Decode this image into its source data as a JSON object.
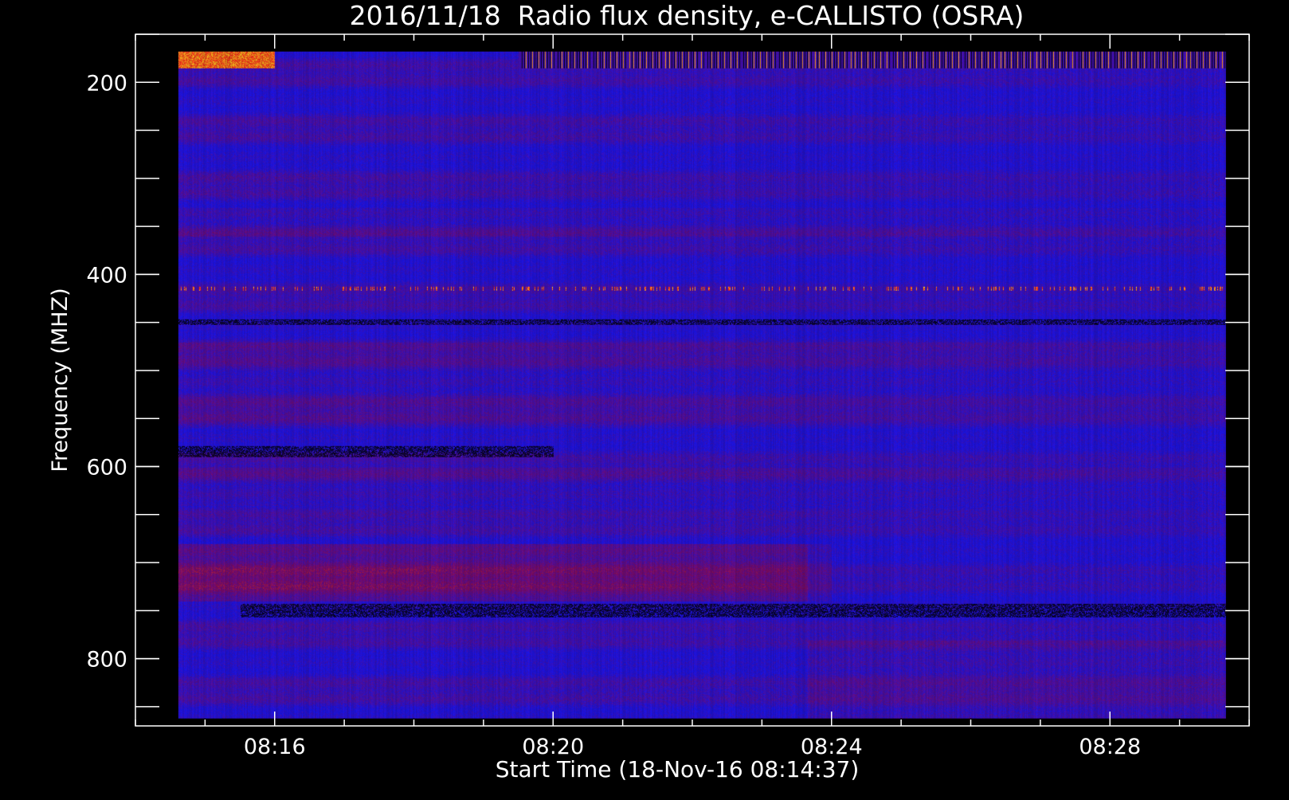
{
  "chart_data": {
    "type": "heatmap",
    "title": "2016/11/18  Radio flux density, e-CALLISTO (OSRA)",
    "xlabel": "Start Time (18-Nov-16 08:14:37)",
    "ylabel": "Frequency (MHZ)",
    "x": {
      "unit": "time of day",
      "start": "08:14:37",
      "range": [
        "08:14:00",
        "08:30:00"
      ],
      "data_range": [
        "08:14:37",
        "08:29:40"
      ],
      "major_ticks": [
        {
          "label": "08:16",
          "value": "08:16"
        },
        {
          "label": "08:20",
          "value": "08:20"
        },
        {
          "label": "08:24",
          "value": "08:24"
        },
        {
          "label": "08:28",
          "value": "08:28"
        }
      ],
      "minor_tick_interval_minutes": 1
    },
    "y": {
      "unit": "MHz",
      "inverted": true,
      "range": [
        150,
        870
      ],
      "data_range": [
        168,
        862
      ],
      "major_ticks": [
        {
          "label": "200",
          "value": 200
        },
        {
          "label": "400",
          "value": 400
        },
        {
          "label": "600",
          "value": 600
        },
        {
          "label": "800",
          "value": 800
        }
      ],
      "minor_tick_interval": 50
    },
    "colormap": [
      "#000000",
      "#0000ff",
      "#8b1a3a",
      "#ff3000",
      "#ffa040"
    ],
    "features": [
      {
        "description_type": "bright band",
        "freq_mhz": [
          168,
          185
        ],
        "time": [
          "08:14:37",
          "08:16:00"
        ],
        "level": "high"
      },
      {
        "description_type": "periodic spikes",
        "freq_mhz": [
          168,
          185
        ],
        "time": [
          "08:19:30",
          "08:29:40"
        ],
        "level": "high"
      },
      {
        "description_type": "intermittent line",
        "freq_mhz": [
          412,
          416
        ],
        "time": [
          "08:14:37",
          "08:29:40"
        ],
        "level": "medium"
      },
      {
        "description_type": "dark band",
        "freq_mhz": [
          446,
          452
        ],
        "time": [
          "08:14:37",
          "08:29:40"
        ],
        "level": "low"
      },
      {
        "description_type": "dark band",
        "freq_mhz": [
          578,
          590
        ],
        "time": [
          "08:14:37",
          "08:20:00"
        ],
        "level": "low"
      },
      {
        "description_type": "dark band",
        "freq_mhz": [
          742,
          756
        ],
        "time": [
          "08:15:30",
          "08:29:40"
        ],
        "level": "low"
      },
      {
        "description_type": "warm band",
        "freq_mhz": [
          680,
          740
        ],
        "time": [
          "08:14:37",
          "08:24:00"
        ],
        "level": "medium"
      }
    ]
  },
  "colors": {
    "background": "#000000",
    "axis": "#ffffff",
    "base": "#1a14e6"
  }
}
